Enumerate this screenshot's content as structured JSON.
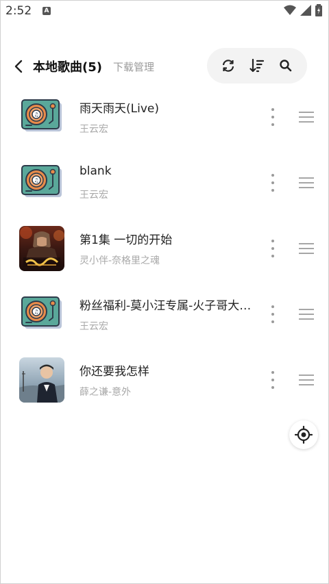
{
  "status_bar": {
    "time": "2:52",
    "notif_icon": "A"
  },
  "header": {
    "title": "本地歌曲(5)",
    "download_manage": "下载管理"
  },
  "toolbar": {
    "icons": [
      "refresh-icon",
      "sort-icon",
      "search-icon"
    ]
  },
  "songs": [
    {
      "title": "雨天雨天(Live)",
      "artist": "王云宏",
      "cover": "turntable"
    },
    {
      "title": "blank",
      "artist": "王云宏",
      "cover": "turntable"
    },
    {
      "title": "第1集 一切的开始",
      "artist": "灵小伴-奈格里之魂",
      "cover": "game-art"
    },
    {
      "title": "粉丝福利-莫小汪专属-火子哥大…",
      "artist": "王云宏",
      "cover": "turntable"
    },
    {
      "title": "你还要我怎样",
      "artist": "薛之谦-意外",
      "cover": "portrait"
    }
  ],
  "colors": {
    "turntable_teal": "#5aa89a",
    "turntable_orange": "#e88b4a",
    "accent_text": "#9a9a9a"
  }
}
